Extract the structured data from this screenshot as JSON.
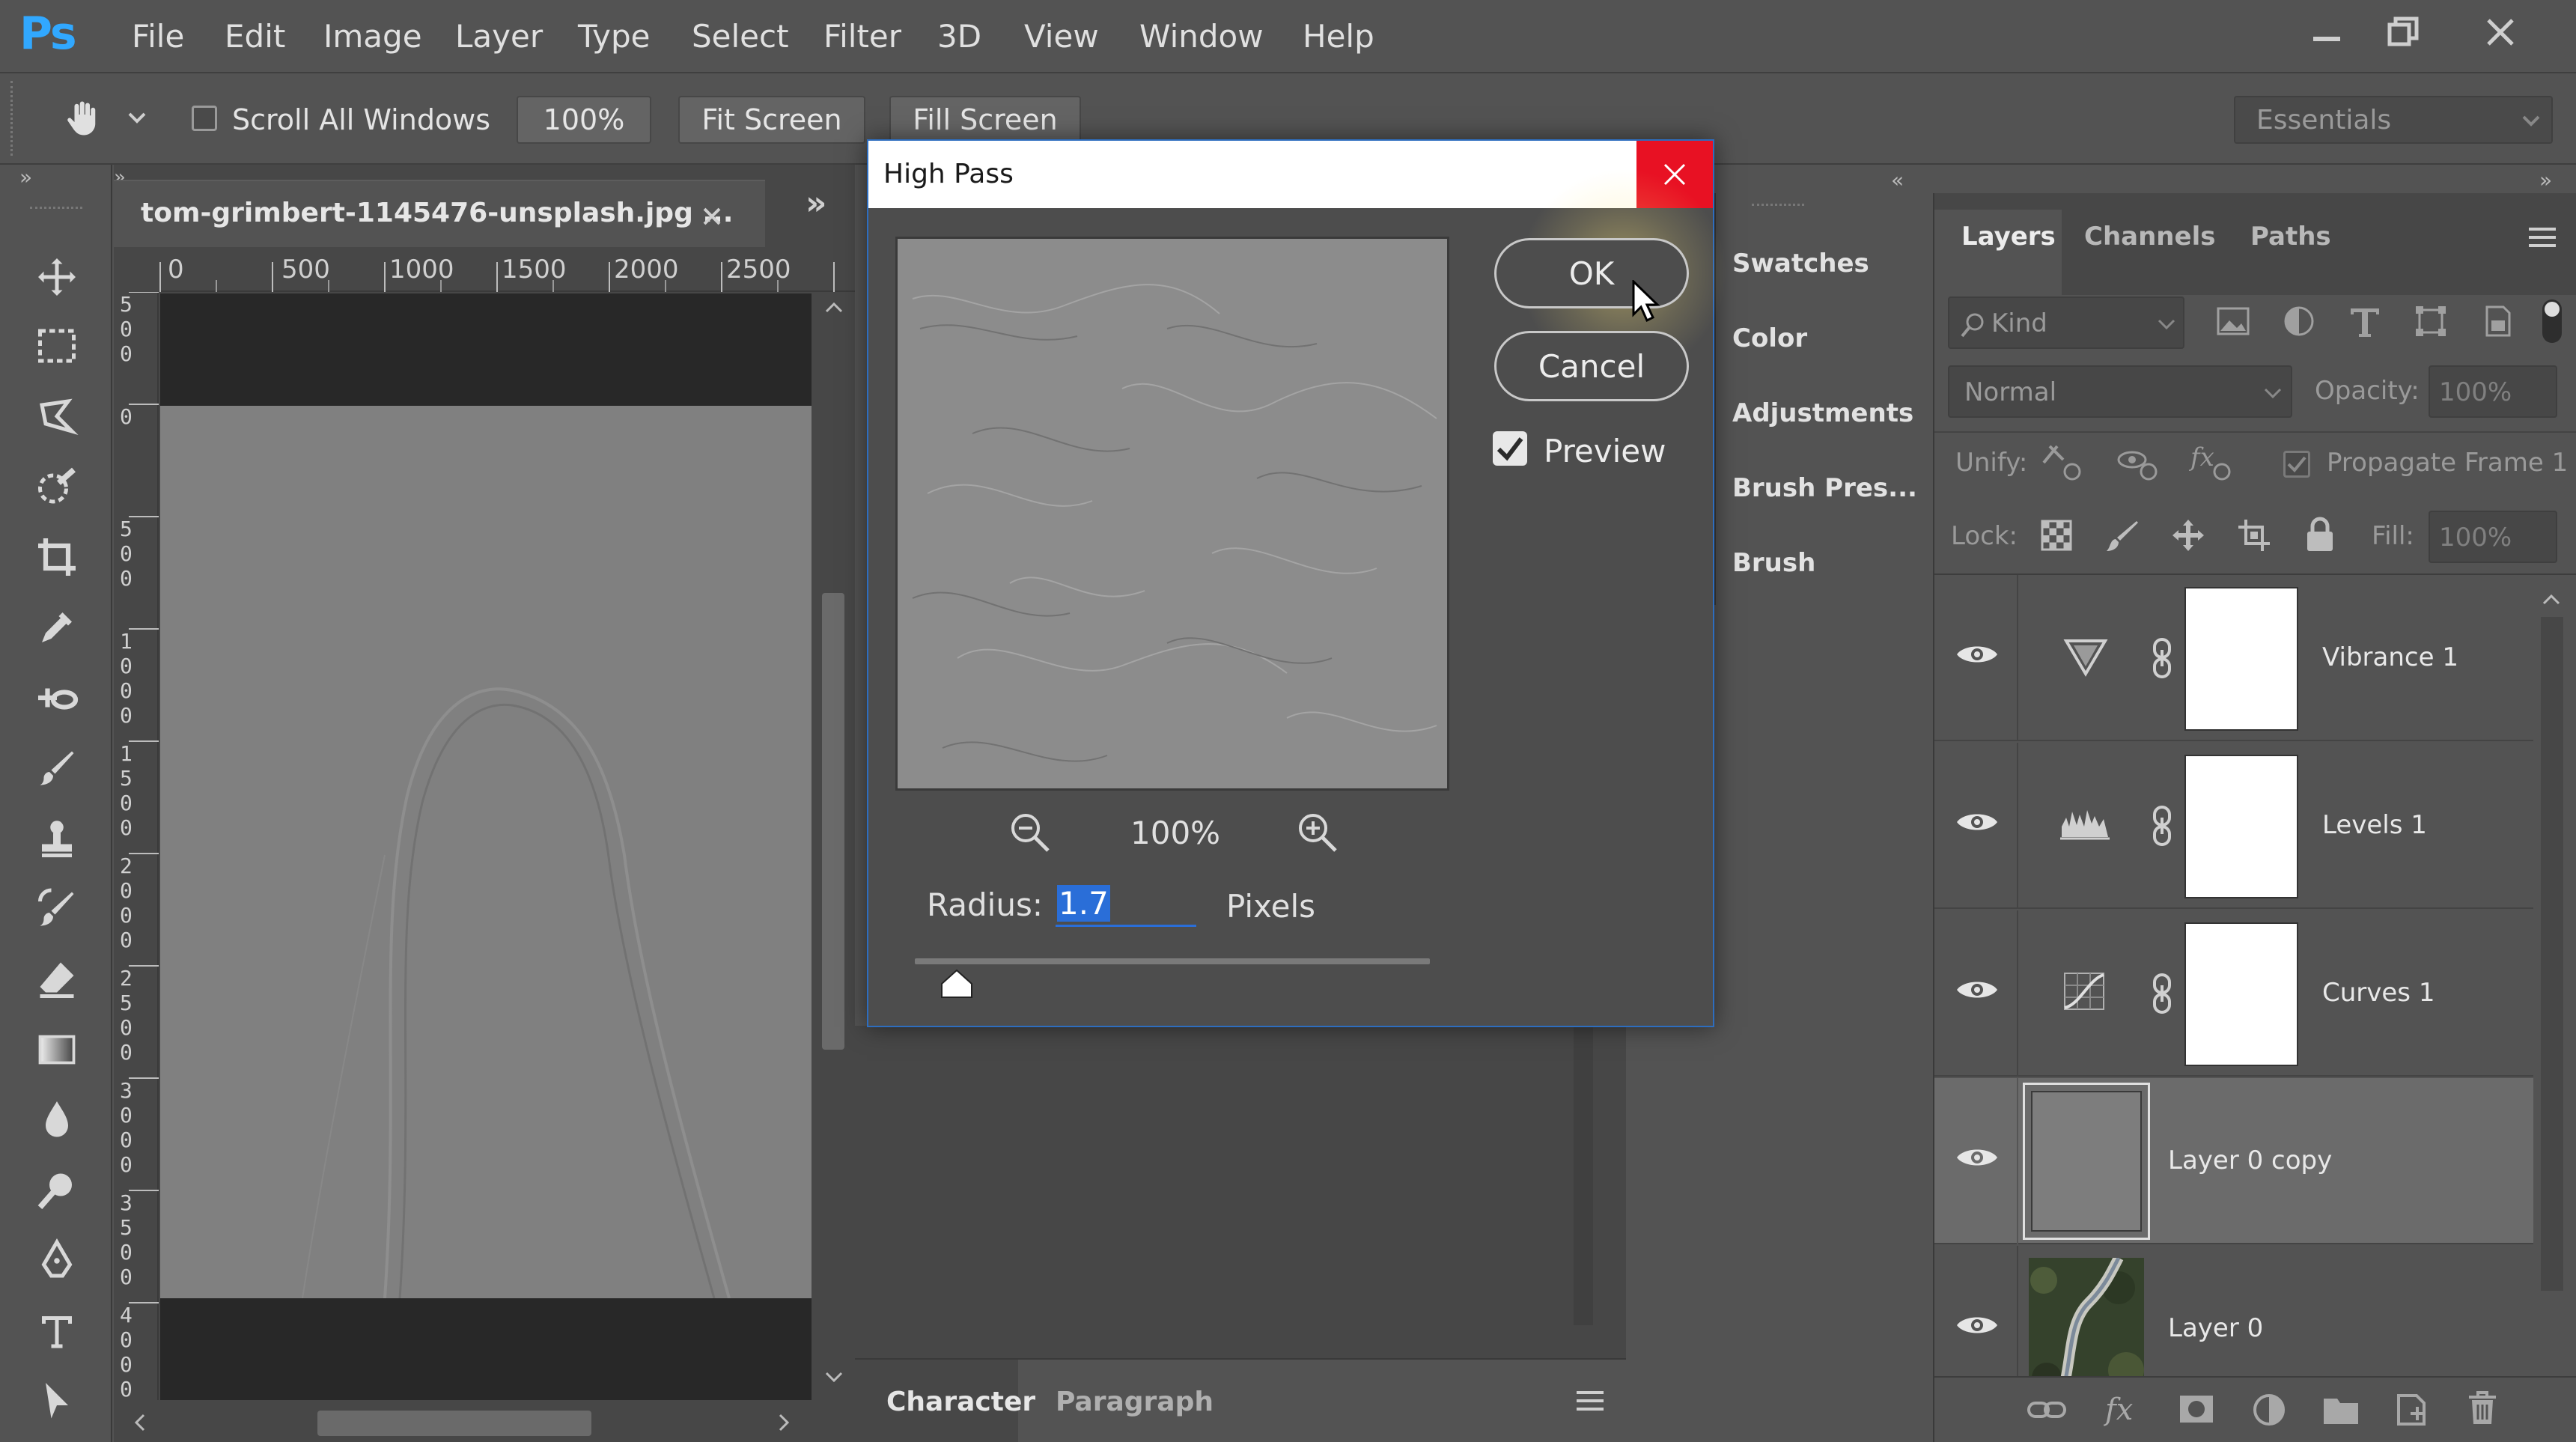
{
  "app": {
    "logo": "Ps"
  },
  "menu": [
    "File",
    "Edit",
    "Image",
    "Layer",
    "Type",
    "Select",
    "Filter",
    "3D",
    "View",
    "Window",
    "Help"
  ],
  "options": {
    "scroll_all_windows": "Scroll All Windows",
    "zoom": "100%",
    "fit_screen": "Fit Screen",
    "fill_screen": "Fill Screen",
    "workspace": "Essentials"
  },
  "document": {
    "tab_title": "tom-grimbert-1145476-unsplash.jpg ...",
    "ruler_top": [
      "0",
      "500",
      "1000",
      "1500",
      "2000",
      "2500"
    ],
    "ruler_left": [
      "5\n0\n0",
      "0",
      "5\n0\n0",
      "1\n0\n0\n0",
      "1\n5\n0\n0",
      "2\n0\n0\n0",
      "2\n5\n0\n0",
      "3\n0\n0\n0",
      "3\n5\n0\n0",
      "4\n0\n0\n0"
    ]
  },
  "bottom_panel": {
    "tabs": [
      "Character",
      "Paragraph"
    ]
  },
  "collapsed_panels": [
    "Swatches",
    "Color",
    "Adjustments",
    "Brush Pres...",
    "Brush"
  ],
  "layers_panel": {
    "tabs": [
      "Layers",
      "Channels",
      "Paths"
    ],
    "filter_label": "Kind",
    "blend_mode": "Normal",
    "opacity_label": "Opacity:",
    "opacity_value": "100%",
    "unify_label": "Unify:",
    "propagate_label": "Propagate Frame 1",
    "lock_label": "Lock:",
    "fill_label": "Fill:",
    "fill_value": "100%",
    "layers": [
      {
        "name": "Vibrance 1",
        "icon": "vibrance-icon"
      },
      {
        "name": "Levels 1",
        "icon": "levels-icon"
      },
      {
        "name": "Curves 1",
        "icon": "curves-icon"
      },
      {
        "name": "Layer 0 copy",
        "icon": "none"
      },
      {
        "name": "Layer 0",
        "icon": "none"
      }
    ]
  },
  "dialog": {
    "title": "High Pass",
    "ok": "OK",
    "cancel": "Cancel",
    "preview_label": "Preview",
    "preview_checked": true,
    "zoom": "100%",
    "radius_label": "Radius:",
    "radius_value": "1.7",
    "radius_unit": "Pixels"
  }
}
